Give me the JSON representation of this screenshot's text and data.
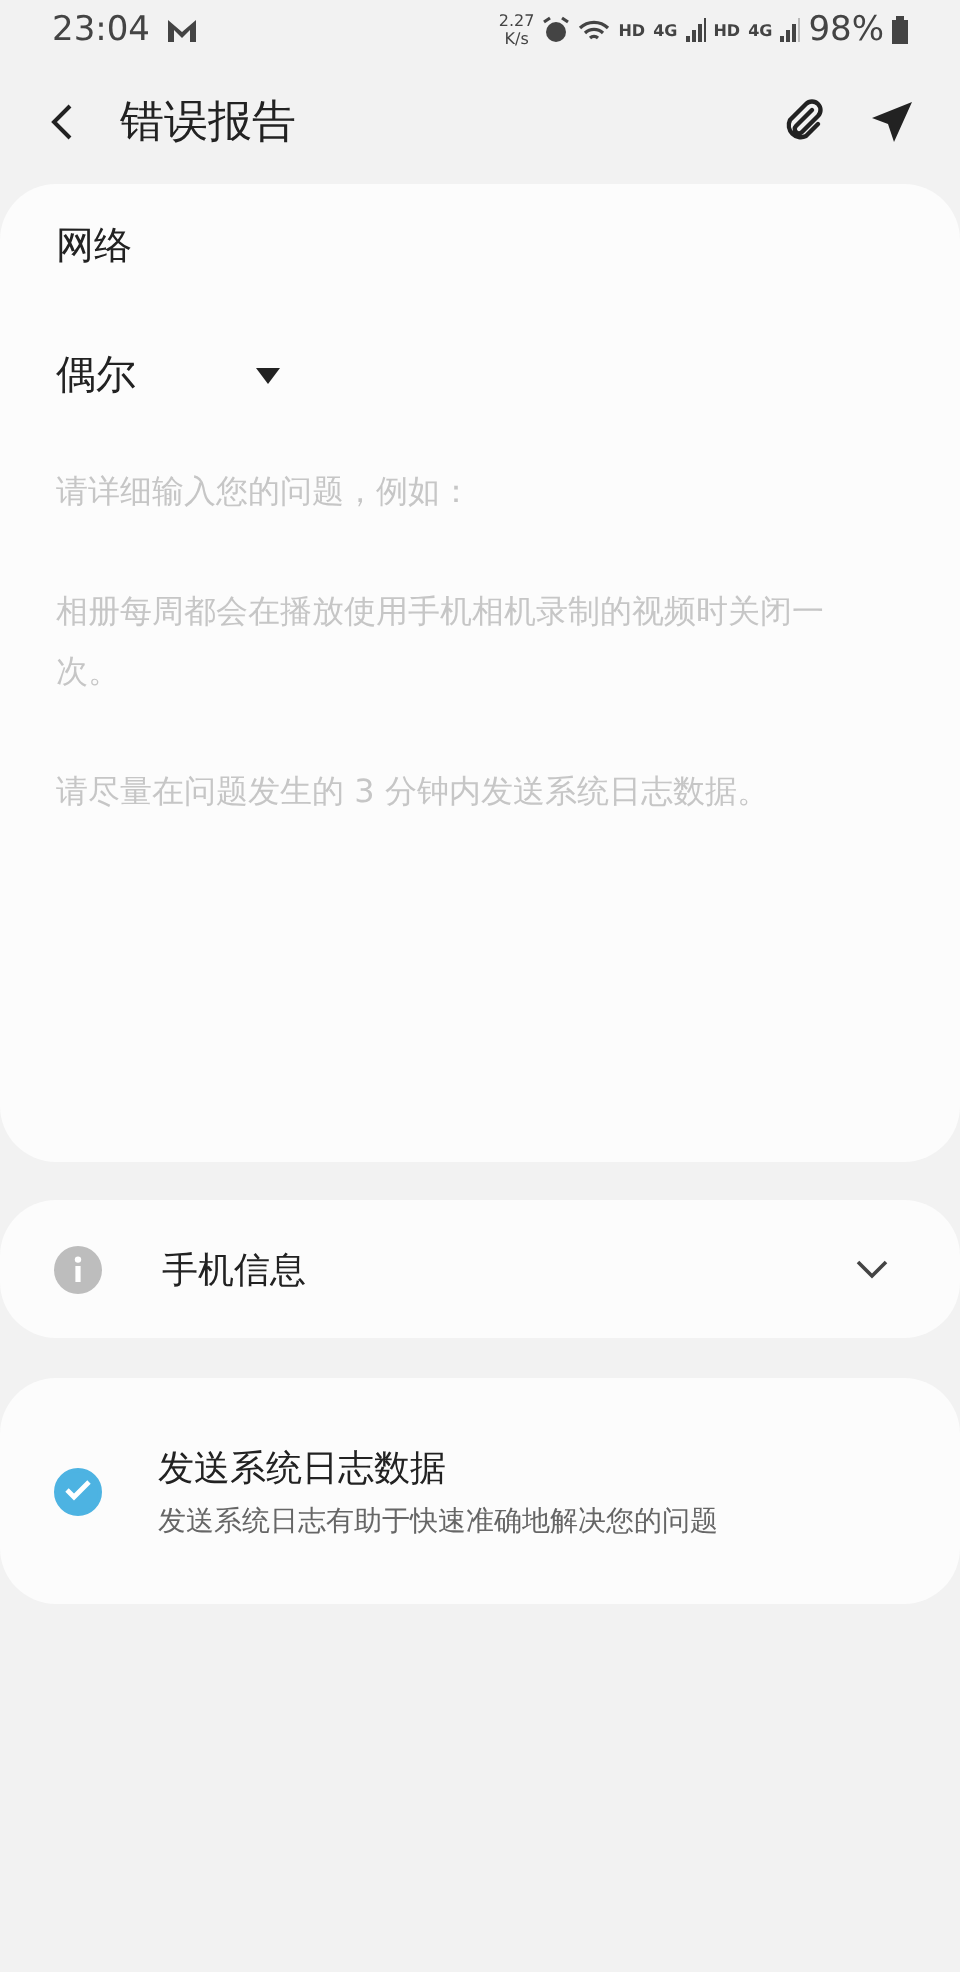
{
  "status_bar": {
    "time": "23:04",
    "speed": "2.27",
    "speed_unit": "K/s",
    "sim_1": {
      "hd": "HD",
      "net": "4G"
    },
    "sim_2": {
      "hd": "HD",
      "net": "4G"
    },
    "battery": "98%"
  },
  "header": {
    "title": "错误报告"
  },
  "report": {
    "category_label": "网络",
    "frequency": "偶尔",
    "placeholder": [
      "请详细输入您的问题，例如：",
      "相册每周都会在播放使用手机相机录制的视频时关闭一次。",
      "请尽量在问题发生的 3 分钟内发送系统日志数据。"
    ]
  },
  "device_info": {
    "label": "手机信息",
    "expanded": false
  },
  "system_log": {
    "title": "发送系统日志数据",
    "subtitle": "发送系统日志有助于快速准确地解决您的问题",
    "checked": true
  }
}
